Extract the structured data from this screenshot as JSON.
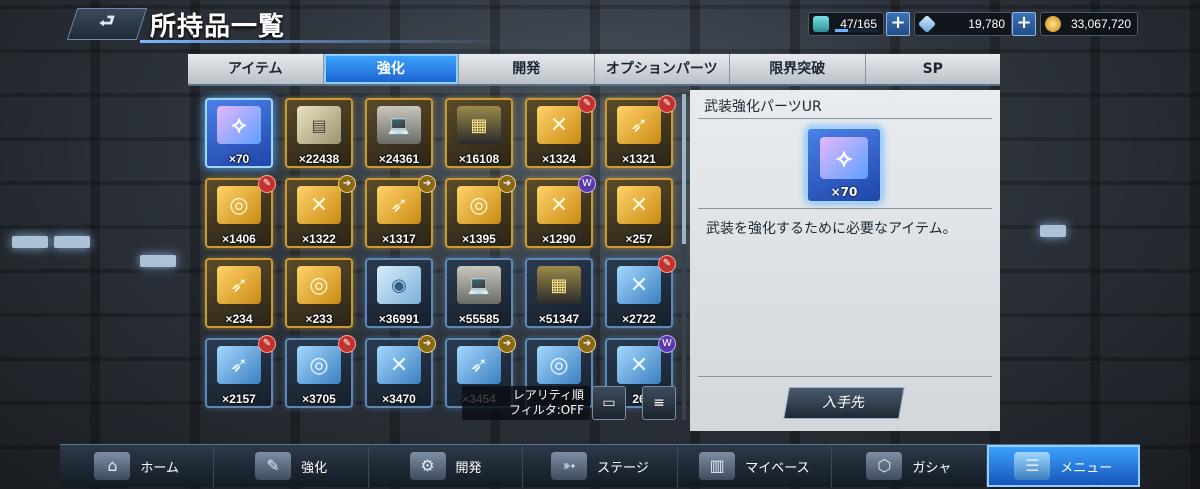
{
  "header": {
    "back_icon": "back-arrow-icon",
    "title": "所持品一覧"
  },
  "resources": [
    {
      "name": "capacity",
      "icon": "storage-icon",
      "value": "47/165",
      "fill": 0.285
    },
    {
      "name": "gems",
      "icon": "crystal-icon",
      "value": "19,780"
    },
    {
      "name": "coins",
      "icon": "coin-icon",
      "value": "33,067,720"
    }
  ],
  "tabs": [
    {
      "label": "アイテム",
      "active": false
    },
    {
      "label": "強化",
      "active": true
    },
    {
      "label": "開発",
      "active": false
    },
    {
      "label": "オプションパーツ",
      "active": false
    },
    {
      "label": "限界突破",
      "active": false
    },
    {
      "label": "SP",
      "active": false
    }
  ],
  "items": [
    {
      "qty": "×70",
      "style": "sel",
      "art": "⟡"
    },
    {
      "qty": "×22438",
      "style": "gold",
      "art": "▤",
      "kind": "card"
    },
    {
      "qty": "×24361",
      "style": "gold",
      "art": "💻",
      "kind": "laptop"
    },
    {
      "qty": "×16108",
      "style": "gold",
      "art": "▦",
      "kind": "chip"
    },
    {
      "qty": "×1324",
      "style": "gold",
      "art": "✕",
      "badge": "red"
    },
    {
      "qty": "×1321",
      "style": "gold",
      "art": "➶",
      "badge": "red"
    },
    {
      "qty": "×1406",
      "style": "gold",
      "art": "◎",
      "badge": "red"
    },
    {
      "qty": "×1322",
      "style": "gold",
      "art": "✕",
      "badge": "gold"
    },
    {
      "qty": "×1317",
      "style": "gold",
      "art": "➶",
      "badge": "gold"
    },
    {
      "qty": "×1395",
      "style": "gold",
      "art": "◎",
      "badge": "gold"
    },
    {
      "qty": "×1290",
      "style": "gold",
      "art": "✕",
      "badge": "purple"
    },
    {
      "qty": "×257",
      "style": "gold",
      "art": "✕"
    },
    {
      "qty": "×234",
      "style": "gold",
      "art": "➶"
    },
    {
      "qty": "×233",
      "style": "gold",
      "art": "◎"
    },
    {
      "qty": "×36991",
      "style": "blue",
      "art": "◉",
      "kind": "disc"
    },
    {
      "qty": "×55585",
      "style": "blue",
      "art": "💻",
      "kind": "laptop"
    },
    {
      "qty": "×51347",
      "style": "blue",
      "art": "▦",
      "kind": "chip"
    },
    {
      "qty": "×2722",
      "style": "blue",
      "art": "✕",
      "badge": "red"
    },
    {
      "qty": "×2157",
      "style": "blue",
      "art": "➶",
      "badge": "red"
    },
    {
      "qty": "×3705",
      "style": "blue",
      "art": "◎",
      "badge": "red"
    },
    {
      "qty": "×3470",
      "style": "blue",
      "art": "✕",
      "badge": "gold"
    },
    {
      "qty": "×3454",
      "style": "blue",
      "art": "➶",
      "badge": "gold"
    },
    {
      "qty": "",
      "style": "blue",
      "art": "◎",
      "badge": "gold"
    },
    {
      "qty": "26",
      "style": "blue",
      "art": "✕",
      "badge": "purple"
    }
  ],
  "sort": {
    "order_label": "レアリティ順",
    "filter_label": "フィルタ:OFF",
    "view_icon": "card-view-icon",
    "sort_icon": "sort-icon"
  },
  "detail": {
    "title": "武装強化パーツUR",
    "qty": "×70",
    "description": "武装を強化するために必要なアイテム。",
    "acquire_label": "入手先"
  },
  "nav": [
    {
      "label": "ホーム",
      "icon": "home-icon",
      "glyph": "⌂"
    },
    {
      "label": "強化",
      "icon": "wrench-icon",
      "glyph": "✎"
    },
    {
      "label": "開発",
      "icon": "factory-icon",
      "glyph": "⚙"
    },
    {
      "label": "ステージ",
      "icon": "rifle-icon",
      "glyph": "➳"
    },
    {
      "label": "マイベース",
      "icon": "base-icon",
      "glyph": "▥"
    },
    {
      "label": "ガシャ",
      "icon": "gacha-icon",
      "glyph": "⬡"
    },
    {
      "label": "メニュー",
      "icon": "menu-icon",
      "glyph": "☰",
      "active": true
    }
  ]
}
